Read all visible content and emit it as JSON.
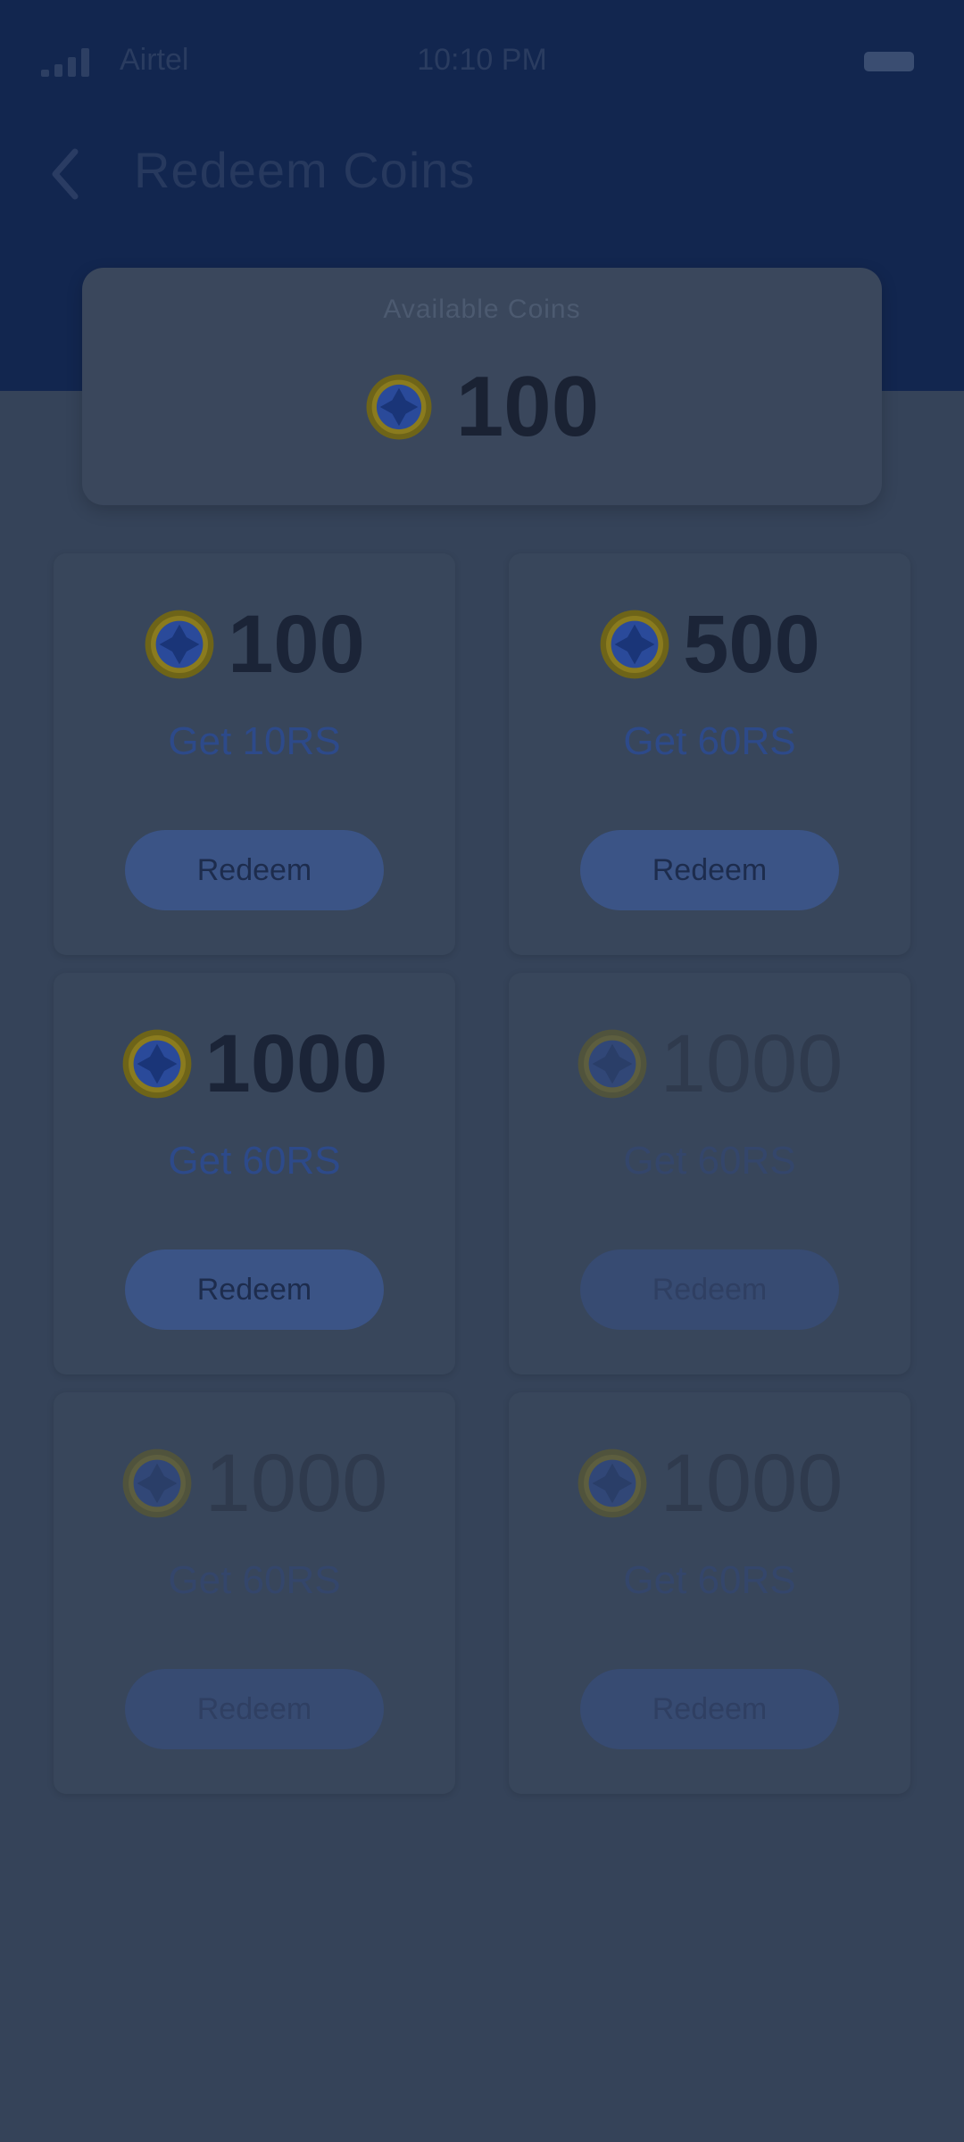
{
  "status_bar": {
    "carrier": "Airtel",
    "time": "10:10 PM"
  },
  "header": {
    "title": "Redeem Coins"
  },
  "balance": {
    "label": "Available Coins",
    "value": "100"
  },
  "offers": [
    {
      "coins": "100",
      "reward": "Get 10RS",
      "button": "Redeem",
      "enabled": true
    },
    {
      "coins": "500",
      "reward": "Get 60RS",
      "button": "Redeem",
      "enabled": true
    },
    {
      "coins": "1000",
      "reward": "Get 60RS",
      "button": "Redeem",
      "enabled": true
    },
    {
      "coins": "1000",
      "reward": "Get 60RS",
      "button": "Redeem",
      "enabled": false
    },
    {
      "coins": "1000",
      "reward": "Get 60RS",
      "button": "Redeem",
      "enabled": false
    },
    {
      "coins": "1000",
      "reward": "Get 60RS",
      "button": "Redeem",
      "enabled": false
    }
  ],
  "colors": {
    "header": "#12264f",
    "overlay": "#354359",
    "coin_gold": "#8a7a1e",
    "coin_blue": "#1f3f8c"
  },
  "icons": {
    "coin": "coin-icon",
    "back": "back-arrow-icon",
    "signal": "signal-icon",
    "battery": "battery-icon"
  }
}
